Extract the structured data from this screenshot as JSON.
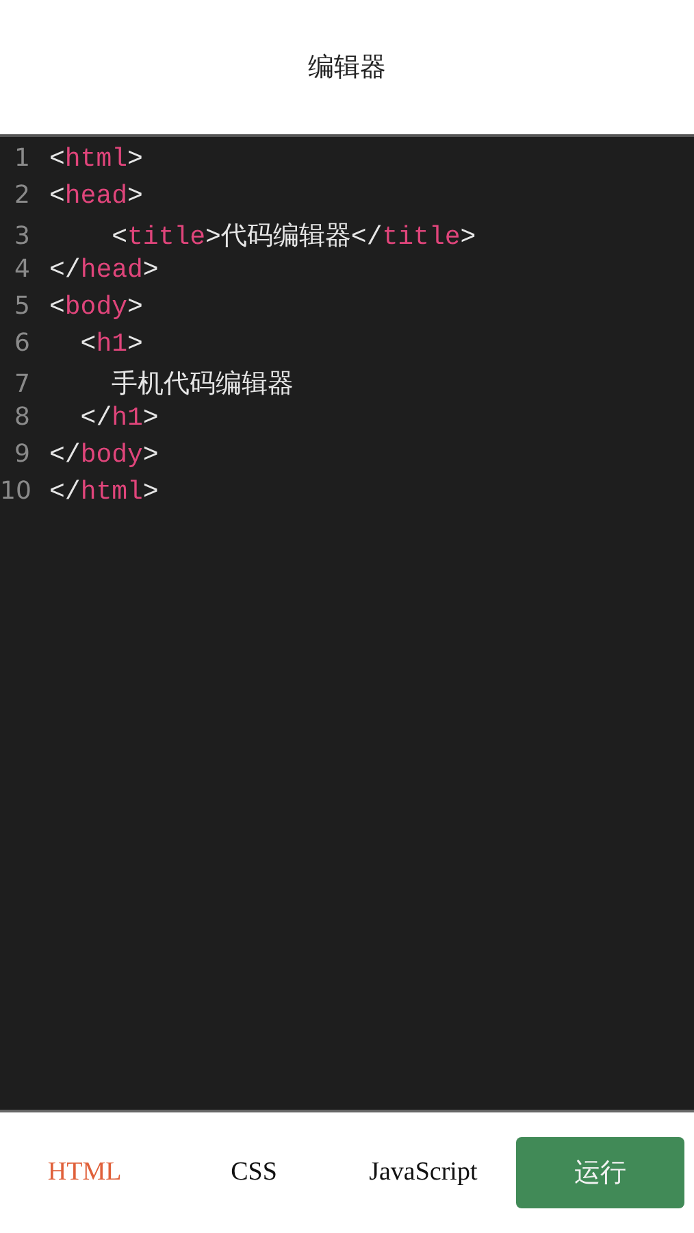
{
  "header": {
    "title": "编辑器"
  },
  "editor": {
    "lines": [
      {
        "number": "1",
        "tokens": [
          {
            "kind": "punct",
            "text": "<"
          },
          {
            "kind": "tag",
            "text": "html"
          },
          {
            "kind": "punct",
            "text": ">"
          }
        ]
      },
      {
        "number": "2",
        "tokens": [
          {
            "kind": "punct",
            "text": "<"
          },
          {
            "kind": "tag",
            "text": "head"
          },
          {
            "kind": "punct",
            "text": ">"
          }
        ]
      },
      {
        "number": "3",
        "tokens": [
          {
            "kind": "punct",
            "text": "    <"
          },
          {
            "kind": "tag",
            "text": "title"
          },
          {
            "kind": "punct",
            "text": ">代码编辑器</"
          },
          {
            "kind": "tag",
            "text": "title"
          },
          {
            "kind": "punct",
            "text": ">"
          }
        ]
      },
      {
        "number": "4",
        "tokens": [
          {
            "kind": "punct",
            "text": "</"
          },
          {
            "kind": "tag",
            "text": "head"
          },
          {
            "kind": "punct",
            "text": ">"
          }
        ]
      },
      {
        "number": "5",
        "tokens": [
          {
            "kind": "punct",
            "text": "<"
          },
          {
            "kind": "tag",
            "text": "body"
          },
          {
            "kind": "punct",
            "text": ">"
          }
        ]
      },
      {
        "number": "6",
        "tokens": [
          {
            "kind": "punct",
            "text": "  <"
          },
          {
            "kind": "tag",
            "text": "h1"
          },
          {
            "kind": "punct",
            "text": ">"
          }
        ]
      },
      {
        "number": "7",
        "tokens": [
          {
            "kind": "punct",
            "text": "    手机代码编辑器"
          }
        ]
      },
      {
        "number": "8",
        "tokens": [
          {
            "kind": "punct",
            "text": "  </"
          },
          {
            "kind": "tag",
            "text": "h1"
          },
          {
            "kind": "punct",
            "text": ">"
          }
        ]
      },
      {
        "number": "9",
        "tokens": [
          {
            "kind": "punct",
            "text": "</"
          },
          {
            "kind": "tag",
            "text": "body"
          },
          {
            "kind": "punct",
            "text": ">"
          }
        ]
      },
      {
        "number": "10",
        "tokens": [
          {
            "kind": "punct",
            "text": "</"
          },
          {
            "kind": "tag",
            "text": "html"
          },
          {
            "kind": "punct",
            "text": ">"
          }
        ]
      }
    ]
  },
  "tabs": [
    {
      "label": "HTML",
      "selected": true
    },
    {
      "label": "CSS",
      "selected": false
    },
    {
      "label": "JavaScript",
      "selected": false
    }
  ],
  "run_button": {
    "label": "运行"
  }
}
